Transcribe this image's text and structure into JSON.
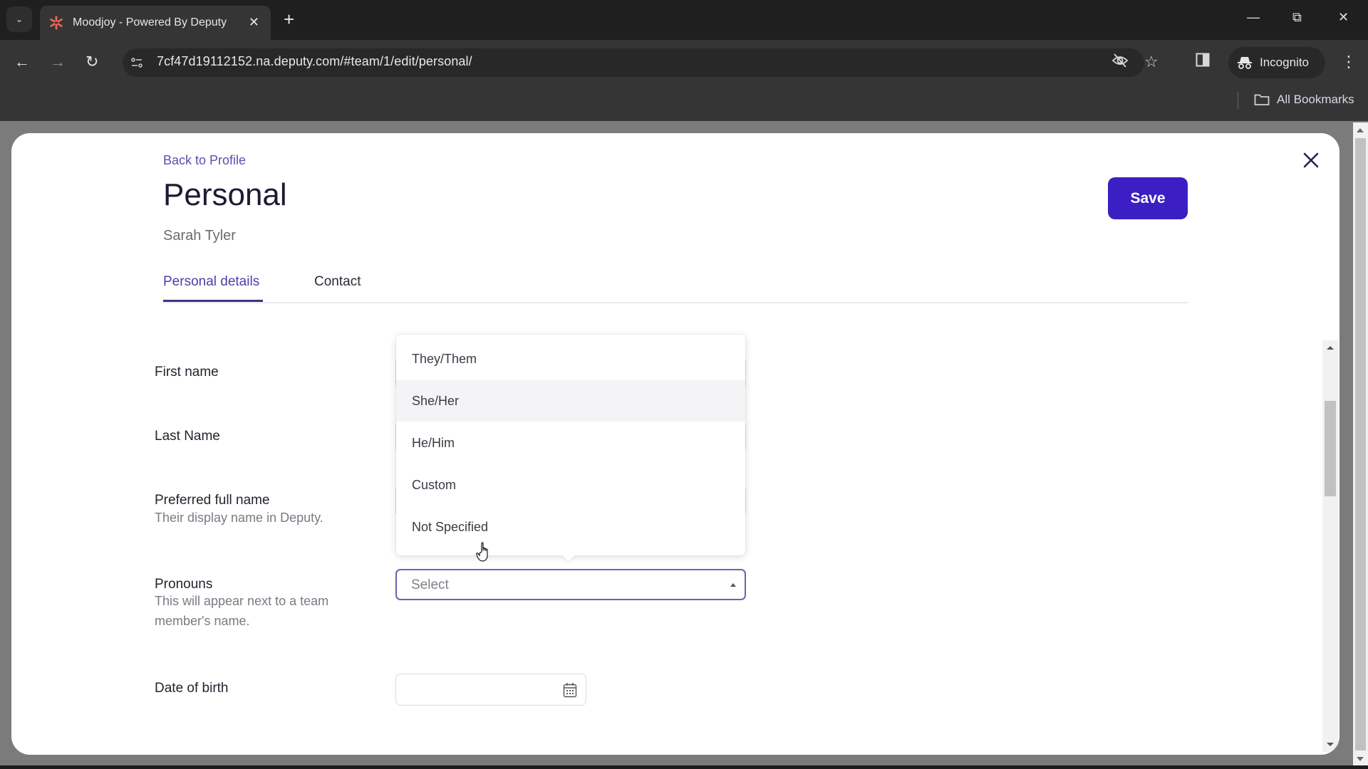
{
  "browser": {
    "tab_title": "Moodjoy - Powered By Deputy",
    "url": "7cf47d19112152.na.deputy.com/#team/1/edit/personal/",
    "incognito_label": "Incognito",
    "bookmarks_label": "All Bookmarks"
  },
  "header": {
    "back_link": "Back to Profile",
    "title": "Personal",
    "subtitle": "Sarah Tyler",
    "save_label": "Save"
  },
  "tabs": [
    {
      "label": "Personal details",
      "active": true
    },
    {
      "label": "Contact",
      "active": false
    }
  ],
  "form": {
    "first_name": {
      "label": "First name"
    },
    "last_name": {
      "label": "Last Name"
    },
    "preferred_full_name": {
      "label": "Preferred full name",
      "help": "Their display name in Deputy."
    },
    "pronouns": {
      "label": "Pronouns",
      "help": "This will appear next to a team member's name.",
      "placeholder": "Select",
      "options": [
        "They/Them",
        "She/Her",
        "He/Him",
        "Custom",
        "Not Specified"
      ],
      "hovered_option": "She/Her"
    },
    "date_of_birth": {
      "label": "Date of birth",
      "value": ""
    }
  },
  "colors": {
    "accent": "#3b1fc4",
    "link": "#5a4fb0",
    "tab_active": "#4b3fa8",
    "backdrop": "#7b7b7b"
  }
}
